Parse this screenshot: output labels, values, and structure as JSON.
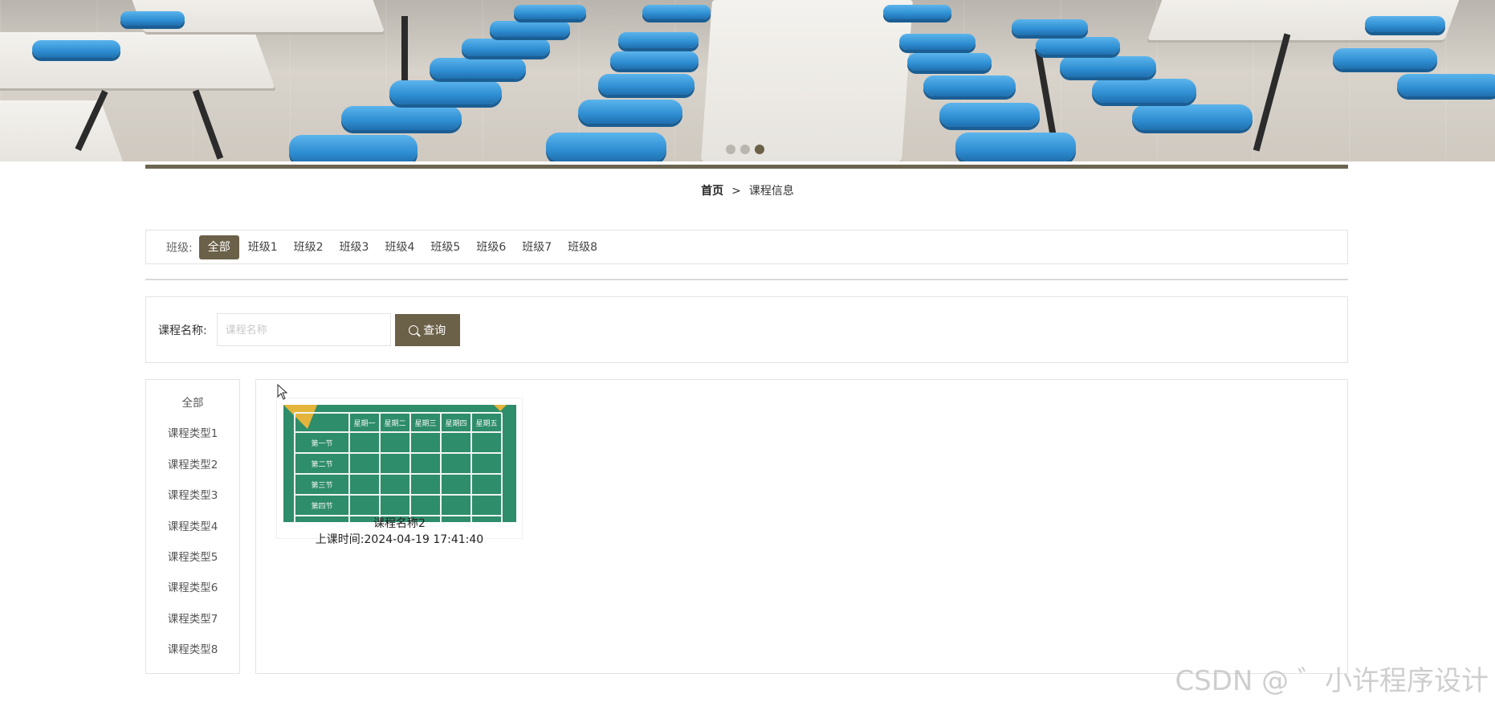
{
  "banner": {
    "slide_count": 3,
    "active_slide": 3
  },
  "breadcrumb": {
    "home": "首页",
    "separator": ">",
    "current": "课程信息"
  },
  "class_filter": {
    "label": "班级:",
    "items": [
      "全部",
      "班级1",
      "班级2",
      "班级3",
      "班级4",
      "班级5",
      "班级6",
      "班级7",
      "班级8"
    ],
    "active": "全部"
  },
  "search": {
    "label": "课程名称:",
    "placeholder": "课程名称",
    "value": "",
    "button_label": "查询"
  },
  "course_types": [
    "全部",
    "课程类型1",
    "课程类型2",
    "课程类型3",
    "课程类型4",
    "课程类型5",
    "课程类型6",
    "课程类型7",
    "课程类型8"
  ],
  "courses": [
    {
      "name": "课程名称2",
      "time": "上课时间:2024-04-19 17:41:40",
      "timetable": {
        "days": [
          "星期一",
          "星期二",
          "星期三",
          "星期四",
          "星期五"
        ],
        "periods": [
          "第一节",
          "第二节",
          "第三节",
          "第四节"
        ]
      }
    }
  ],
  "theme": {
    "accent": "#6b6048",
    "border": "#e3e3e3",
    "chalkboard": "#2d8a68"
  },
  "watermark": "CSDN @ ゛小许程序设计"
}
